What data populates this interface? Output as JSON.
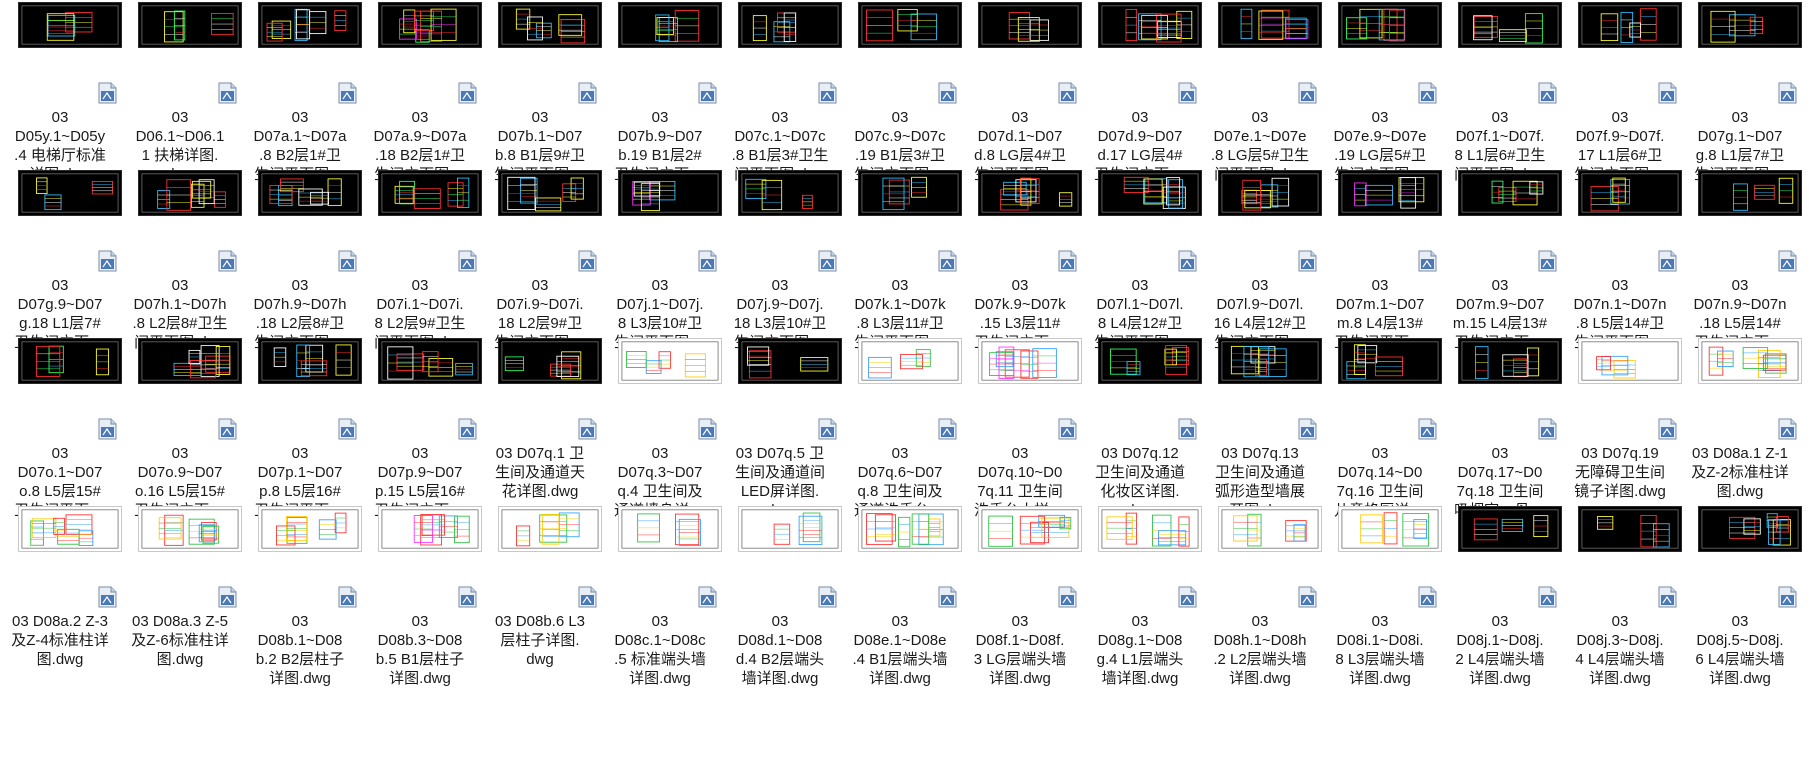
{
  "rows": [
    {
      "thumbs": [
        {
          "style": "dark",
          "accents": [
            "#ff3030",
            "#30c0ff",
            "#ffff30",
            "#30ff60"
          ]
        },
        {
          "style": "dark",
          "accents": [
            "#ffff30",
            "#ff3030",
            "#30ff60",
            "#ffffff"
          ]
        },
        {
          "style": "dark",
          "accents": [
            "#ff3030",
            "#ffffff",
            "#30c0ff",
            "#ffff30"
          ]
        },
        {
          "style": "dark",
          "accents": [
            "#ff3030",
            "#ffff30",
            "#30ff60",
            "#ff30ff"
          ]
        },
        {
          "style": "dark",
          "accents": [
            "#ffff30",
            "#ff3030",
            "#30c0ff",
            "#ffffff"
          ]
        },
        {
          "style": "dark",
          "accents": [
            "#ff3030",
            "#30ff60",
            "#ffff30",
            "#30c0ff"
          ]
        },
        {
          "style": "dark",
          "accents": [
            "#30c0ff",
            "#ffff30",
            "#ff3030",
            "#ffffff"
          ]
        },
        {
          "style": "dark",
          "accents": [
            "#ff3030",
            "#30c0ff",
            "#ffff30",
            "#30ff60"
          ]
        },
        {
          "style": "dark",
          "accents": [
            "#ffffff",
            "#ff3030",
            "#ffff30",
            "#30c0ff"
          ]
        },
        {
          "style": "dark",
          "accents": [
            "#ff3030",
            "#ffff30",
            "#30c0ff",
            "#ffffff"
          ]
        },
        {
          "style": "dark",
          "accents": [
            "#30c0ff",
            "#ff3030",
            "#ffff30",
            "#ff30ff"
          ]
        },
        {
          "style": "dark",
          "accents": [
            "#ff3030",
            "#ffff30",
            "#30c0ff",
            "#30ff60"
          ]
        },
        {
          "style": "dark",
          "accents": [
            "#ff3030",
            "#30ff60",
            "#ffff30",
            "#ffffff"
          ]
        },
        {
          "style": "dark",
          "accents": [
            "#ff3030",
            "#30c0ff",
            "#ffffff",
            "#ffff30"
          ]
        },
        {
          "style": "dark",
          "accents": [
            "#30c0ff",
            "#ffff30",
            "#ff3030",
            "#ffffff"
          ]
        }
      ],
      "items": [
        {
          "lines": [
            "03",
            "D05y.1~D05y",
            ".4 电梯厅标准",
            "详图.dwg"
          ]
        },
        {
          "lines": [
            "03",
            "D06.1~D06.1",
            "1 扶梯详图.",
            "dwg"
          ]
        },
        {
          "lines": [
            "03",
            "D07a.1~D07a",
            ".8  B2层1#卫",
            "生间平面图...."
          ]
        },
        {
          "lines": [
            "03",
            "D07a.9~D07a",
            ".18 B2层1#卫",
            "生间立面图...."
          ]
        },
        {
          "lines": [
            "03",
            "D07b.1~D07",
            "b.8 B1层9#卫",
            "生间平面图...."
          ]
        },
        {
          "lines": [
            "03",
            "D07b.9~D07",
            "b.19 B1层2#",
            "卫生间立面...."
          ]
        },
        {
          "lines": [
            "03",
            "D07c.1~D07c",
            ".8 B1层3#卫生",
            "间平面图.dwg"
          ]
        },
        {
          "lines": [
            "03",
            "D07c.9~D07c",
            ".19 B1层3#卫",
            "生间立面图...."
          ]
        },
        {
          "lines": [
            "03",
            "D07d.1~D07",
            "d.8 LG层4#卫",
            "生间平面图...."
          ]
        },
        {
          "lines": [
            "03",
            "D07d.9~D07",
            "d.17 LG层4#",
            "卫生间立面...."
          ]
        },
        {
          "lines": [
            "03",
            "D07e.1~D07e",
            ".8 LG层5#卫生",
            "间平面图.dwg"
          ]
        },
        {
          "lines": [
            "03",
            "D07e.9~D07e",
            ".19 LG层5#卫",
            "生间立面图...."
          ]
        },
        {
          "lines": [
            "03",
            "D07f.1~D07f.",
            "8 L1层6#卫生",
            "间平面图.dwg"
          ]
        },
        {
          "lines": [
            "03",
            "D07f.9~D07f.",
            "17 L1层6#卫",
            "生间立面图...."
          ]
        },
        {
          "lines": [
            "03",
            "D07g.1~D07",
            "g.8 L1层7#卫",
            "生间平面图...."
          ]
        }
      ]
    },
    {
      "thumbs": [
        {
          "style": "dark",
          "accents": [
            "#ff3030",
            "#30c0ff",
            "#ffff30",
            "#ffffff"
          ]
        },
        {
          "style": "dark",
          "accents": [
            "#ffff30",
            "#ff3030",
            "#30c0ff",
            "#ffffff"
          ]
        },
        {
          "style": "dark",
          "accents": [
            "#ff3030",
            "#ffffff",
            "#30c0ff",
            "#ffff30"
          ]
        },
        {
          "style": "dark",
          "accents": [
            "#ff3030",
            "#ffff30",
            "#30ff60",
            "#30c0ff"
          ]
        },
        {
          "style": "dark",
          "accents": [
            "#ffff30",
            "#ff3030",
            "#30c0ff",
            "#ffffff"
          ]
        },
        {
          "style": "dark",
          "accents": [
            "#ff30ff",
            "#30c0ff",
            "#ffff30",
            "#ffffff"
          ]
        },
        {
          "style": "dark",
          "accents": [
            "#ff3030",
            "#30c0ff",
            "#ffff30",
            "#30ff60"
          ]
        },
        {
          "style": "dark",
          "accents": [
            "#ff3030",
            "#ffff30",
            "#30c0ff",
            "#ffffff"
          ]
        },
        {
          "style": "dark",
          "accents": [
            "#ffff30",
            "#ff3030",
            "#30c0ff",
            "#ffffff"
          ]
        },
        {
          "style": "dark",
          "accents": [
            "#30c0ff",
            "#ffffff",
            "#ff3030",
            "#ffff30"
          ]
        },
        {
          "style": "dark",
          "accents": [
            "#ff3030",
            "#30c0ff",
            "#ffff30",
            "#ffffff"
          ]
        },
        {
          "style": "dark",
          "accents": [
            "#ffff30",
            "#ff30ff",
            "#30c0ff",
            "#ffffff"
          ]
        },
        {
          "style": "dark",
          "accents": [
            "#ff3030",
            "#ffff30",
            "#30ff60",
            "#ffffff"
          ]
        },
        {
          "style": "dark",
          "accents": [
            "#ff3030",
            "#30c0ff",
            "#ffff30",
            "#ffffff"
          ]
        },
        {
          "style": "dark",
          "accents": [
            "#ff3030",
            "#ffff30",
            "#30c0ff",
            "#30ff60"
          ]
        }
      ],
      "items": [
        {
          "lines": [
            "03",
            "D07g.9~D07",
            "g.18 L1层7#",
            "卫生间立面...."
          ]
        },
        {
          "lines": [
            "03",
            "D07h.1~D07h",
            ".8 L2层8#卫生",
            "间平面图.dwg"
          ]
        },
        {
          "lines": [
            "03",
            "D07h.9~D07h",
            ".18 L2层8#卫",
            "生间立面图...."
          ]
        },
        {
          "lines": [
            "03",
            "D07i.1~D07i.",
            "8 L2层9#卫生",
            "间平面图.dwg"
          ]
        },
        {
          "lines": [
            "03",
            "D07i.9~D07i.",
            "18 L2层9#卫",
            "生间立面图...."
          ]
        },
        {
          "lines": [
            "03",
            "D07j.1~D07j.",
            "8 L3层10#卫",
            "生间平面图...."
          ]
        },
        {
          "lines": [
            "03",
            "D07j.9~D07j.",
            "18 L3层10#卫",
            "生间立面图...."
          ]
        },
        {
          "lines": [
            "03",
            "D07k.1~D07k",
            ".8 L3层11#卫",
            "生间平面图...."
          ]
        },
        {
          "lines": [
            "03",
            "D07k.9~D07k",
            ".15 L3层11#",
            "卫生间立面...."
          ]
        },
        {
          "lines": [
            "03",
            "D07l.1~D07l.",
            "8 L4层12#卫",
            "生间平面图...."
          ]
        },
        {
          "lines": [
            "03",
            "D07l.9~D07l.",
            "16 L4层12#卫",
            "生间立面图...."
          ]
        },
        {
          "lines": [
            "03",
            "D07m.1~D07",
            "m.8 L4层13#",
            "卫生间平面...."
          ]
        },
        {
          "lines": [
            "03",
            "D07m.9~D07",
            "m.15 L4层13#",
            "卫生间立面...."
          ]
        },
        {
          "lines": [
            "03",
            "D07n.1~D07n",
            ".8 L5层14#卫",
            "生间平面图...."
          ]
        },
        {
          "lines": [
            "03",
            "D07n.9~D07n",
            ".18 L5层14#",
            "卫生间立面...."
          ]
        }
      ]
    },
    {
      "thumbs": [
        {
          "style": "dark",
          "accents": [
            "#30ff60",
            "#ff3030",
            "#ffff30",
            "#30c0ff"
          ]
        },
        {
          "style": "dark",
          "accents": [
            "#ff3030",
            "#ffffff",
            "#ffff30",
            "#30c0ff"
          ]
        },
        {
          "style": "dark",
          "accents": [
            "#ffffff",
            "#30c0ff",
            "#ffff30",
            "#ff3030"
          ]
        },
        {
          "style": "dark",
          "accents": [
            "#ff3030",
            "#ffffff",
            "#30c0ff",
            "#ffff30"
          ]
        },
        {
          "style": "dark",
          "accents": [
            "#ffff30",
            "#ff3030",
            "#30ff60",
            "#ffffff"
          ]
        },
        {
          "style": "white",
          "accents": [
            "#ff3030",
            "#30a0ff",
            "#30c040",
            "#ffcc00"
          ]
        },
        {
          "style": "dark",
          "accents": [
            "#ff3030",
            "#ffff30",
            "#ffffff",
            "#30c0ff"
          ]
        },
        {
          "style": "white",
          "accents": [
            "#30c040",
            "#ff3030",
            "#30a0ff",
            "#ffcc00"
          ]
        },
        {
          "style": "white",
          "accents": [
            "#ff3030",
            "#30a0ff",
            "#30c040",
            "#ff30ff"
          ]
        },
        {
          "style": "dark",
          "accents": [
            "#ff3030",
            "#ffff30",
            "#30ff60",
            "#30c0ff"
          ]
        },
        {
          "style": "dark",
          "accents": [
            "#30c0ff",
            "#ffffff",
            "#ffff30",
            "#ff3030"
          ]
        },
        {
          "style": "dark",
          "accents": [
            "#ffffff",
            "#30c0ff",
            "#ffff30",
            "#ff3030"
          ]
        },
        {
          "style": "dark",
          "accents": [
            "#ffff30",
            "#ff3030",
            "#30c0ff",
            "#ffffff"
          ]
        },
        {
          "style": "white",
          "accents": [
            "#ffcc00",
            "#30a0ff",
            "#ff3030",
            "#30c040"
          ]
        },
        {
          "style": "white",
          "accents": [
            "#ff3030",
            "#30c040",
            "#30a0ff",
            "#ffcc00"
          ]
        }
      ],
      "items": [
        {
          "lines": [
            "03",
            "D07o.1~D07",
            "o.8 L5层15#",
            "卫生间平面...."
          ]
        },
        {
          "lines": [
            "03",
            "D07o.9~D07",
            "o.16 L5层15#",
            "卫生间立面...."
          ]
        },
        {
          "lines": [
            "03",
            "D07p.1~D07",
            "p.8 L5层16#",
            "卫生间平面...."
          ]
        },
        {
          "lines": [
            "03",
            "D07p.9~D07",
            "p.15 L5层16#",
            "卫生间立面...."
          ]
        },
        {
          "lines": [
            "03 D07q.1 卫",
            "生间及通道天",
            "花详图.dwg"
          ]
        },
        {
          "lines": [
            "03",
            "D07q.3~D07",
            "q.4  卫生间及",
            "通道墙身详...."
          ]
        },
        {
          "lines": [
            "03 D07q.5 卫",
            "生间及通道间",
            "LED屏详图.",
            "dwg"
          ]
        },
        {
          "lines": [
            "03",
            "D07q.6~D07",
            "q.8 卫生间及",
            "通道洗手台...."
          ]
        },
        {
          "lines": [
            "03",
            "D07q.10~D0",
            "7q.11 卫生间",
            "洗手台大样...."
          ]
        },
        {
          "lines": [
            "03 D07q.12",
            "卫生间及通道",
            "化妆区详图.",
            "dwg"
          ]
        },
        {
          "lines": [
            "03 D07q.13",
            "卫生间及通道",
            "弧形造型墙展",
            "开图.dwg"
          ]
        },
        {
          "lines": [
            "03",
            "D07q.14~D0",
            "7q.16 卫生间",
            "儿童格厕详...."
          ]
        },
        {
          "lines": [
            "03",
            "D07q.17~D0",
            "7q.18 卫生间",
            "吸烟室、母...."
          ]
        },
        {
          "lines": [
            "03 D07q.19",
            "无障碍卫生间",
            "镜子详图.dwg"
          ]
        },
        {
          "lines": [
            "03 D08a.1 Z-1",
            "及Z-2标准柱详",
            "图.dwg"
          ]
        }
      ]
    },
    {
      "thumbs": [
        {
          "style": "white",
          "accents": [
            "#ff3030",
            "#30c040",
            "#30a0ff",
            "#ffcc00"
          ]
        },
        {
          "style": "white",
          "accents": [
            "#ff3030",
            "#30c040",
            "#30a0ff",
            "#ffcc00"
          ]
        },
        {
          "style": "white",
          "accents": [
            "#ff3030",
            "#30c040",
            "#30a0ff",
            "#ffcc00"
          ]
        },
        {
          "style": "white",
          "accents": [
            "#ff3030",
            "#30c040",
            "#30a0ff",
            "#ff30ff"
          ]
        },
        {
          "style": "white",
          "accents": [
            "#ff3030",
            "#30c040",
            "#30a0ff",
            "#ffcc00"
          ]
        },
        {
          "style": "white",
          "accents": [
            "#ff3030",
            "#30c040",
            "#30a0ff",
            "#ffcc00"
          ]
        },
        {
          "style": "white",
          "accents": [
            "#ff3030",
            "#30c040",
            "#30a0ff",
            "#ffcc00"
          ]
        },
        {
          "style": "white",
          "accents": [
            "#ff3030",
            "#30c040",
            "#30a0ff",
            "#ffcc00"
          ]
        },
        {
          "style": "white",
          "accents": [
            "#ff3030",
            "#30c040",
            "#30a0ff",
            "#ffcc00"
          ]
        },
        {
          "style": "white",
          "accents": [
            "#ff3030",
            "#30c040",
            "#30a0ff",
            "#ffcc00"
          ]
        },
        {
          "style": "white",
          "accents": [
            "#ff3030",
            "#30c040",
            "#30a0ff",
            "#ffcc00"
          ]
        },
        {
          "style": "white",
          "accents": [
            "#ff3030",
            "#30c040",
            "#30a0ff",
            "#ffcc00"
          ]
        },
        {
          "style": "dark",
          "accents": [
            "#ff3030",
            "#30c0ff",
            "#ffff30",
            "#ffffff"
          ]
        },
        {
          "style": "dark",
          "accents": [
            "#ff3030",
            "#ffff30",
            "#30c0ff",
            "#ffffff"
          ]
        },
        {
          "style": "dark",
          "accents": [
            "#ff3030",
            "#30c0ff",
            "#ffff30",
            "#ffffff"
          ]
        }
      ],
      "items": [
        {
          "lines": [
            "03 D08a.2 Z-3",
            "及Z-4标准柱详",
            "图.dwg"
          ]
        },
        {
          "lines": [
            "03 D08a.3 Z-5",
            "及Z-6标准柱详",
            "图.dwg"
          ]
        },
        {
          "lines": [
            "03",
            "D08b.1~D08",
            "b.2 B2层柱子",
            "详图.dwg"
          ]
        },
        {
          "lines": [
            "03",
            "D08b.3~D08",
            "b.5 B1层柱子",
            "详图.dwg"
          ]
        },
        {
          "lines": [
            "03 D08b.6 L3",
            "层柱子详图.",
            "dwg"
          ]
        },
        {
          "lines": [
            "03",
            "D08c.1~D08c",
            ".5 标准端头墙",
            "详图.dwg"
          ]
        },
        {
          "lines": [
            "03",
            "D08d.1~D08",
            "d.4 B2层端头",
            "墙详图.dwg"
          ]
        },
        {
          "lines": [
            "03",
            "D08e.1~D08e",
            ".4 B1层端头墙",
            "详图.dwg"
          ]
        },
        {
          "lines": [
            "03",
            "D08f.1~D08f.",
            "3 LG层端头墙",
            "详图.dwg"
          ]
        },
        {
          "lines": [
            "03",
            "D08g.1~D08",
            "g.4 L1层端头",
            "墙详图.dwg"
          ]
        },
        {
          "lines": [
            "03",
            "D08h.1~D08h",
            ".2 L2层端头墙",
            "详图.dwg"
          ]
        },
        {
          "lines": [
            "03",
            "D08i.1~D08i.",
            "8 L3层端头墙",
            "详图.dwg"
          ]
        },
        {
          "lines": [
            "03",
            "D08j.1~D08j.",
            "2 L4层端头墙",
            "详图.dwg"
          ]
        },
        {
          "lines": [
            "03",
            "D08j.3~D08j.",
            "4 L4层端头墙",
            "详图.dwg"
          ]
        },
        {
          "lines": [
            "03",
            "D08j.5~D08j.",
            "6 L4层端头墙",
            "详图.dwg"
          ]
        }
      ]
    }
  ],
  "icons": {
    "file_icon": "dwg-file-icon"
  }
}
